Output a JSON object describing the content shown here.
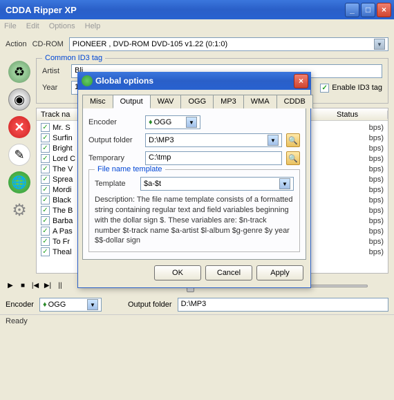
{
  "window": {
    "title": "CDDA Ripper XP"
  },
  "menu": {
    "file": "File",
    "edit": "Edit",
    "options": "Options",
    "help": "Help"
  },
  "actionbar": {
    "action": "Action",
    "cdrom": "CD-ROM",
    "device": "PIONEER , DVD-ROM DVD-105  v1.22 (0:1:0)"
  },
  "id3": {
    "legend": "Common ID3 tag",
    "artist_label": "Artist",
    "artist_value": "Bli",
    "year_label": "Year",
    "year_value": "19",
    "enable_label": "Enable ID3 tag"
  },
  "tracks": {
    "header": {
      "name": "Track na",
      "status": "Status"
    },
    "items": [
      {
        "name": "Mr. S",
        "status": "bps)"
      },
      {
        "name": "Surfin",
        "status": "bps)"
      },
      {
        "name": "Bright",
        "status": "bps)"
      },
      {
        "name": "Lord C",
        "status": "bps)"
      },
      {
        "name": "The V",
        "status": "bps)"
      },
      {
        "name": "Sprea",
        "status": "bps)"
      },
      {
        "name": "Mordi",
        "status": "bps)"
      },
      {
        "name": "Black",
        "status": "bps)"
      },
      {
        "name": "The B",
        "status": "bps)"
      },
      {
        "name": "Barba",
        "status": "bps)"
      },
      {
        "name": "A Pas",
        "status": "bps)"
      },
      {
        "name": "To Fr",
        "status": "bps)"
      },
      {
        "name": "Theal",
        "status": "bps)"
      }
    ]
  },
  "bottom": {
    "encoder_label": "Encoder",
    "encoder_value": "OGG",
    "output_label": "Output folder",
    "output_value": "D:\\MP3"
  },
  "status": "Ready",
  "dialog": {
    "title": "Global options",
    "tabs": {
      "misc": "Misc",
      "output": "Output",
      "wav": "WAV",
      "ogg": "OGG",
      "mp3": "MP3",
      "wma": "WMA",
      "cddb": "CDDB"
    },
    "encoder_label": "Encoder",
    "encoder_value": "OGG",
    "output_label": "Output folder",
    "output_value": "D:\\MP3",
    "temp_label": "Temporary",
    "temp_value": "C:\\tmp",
    "template_legend": "File name template",
    "template_label": "Template",
    "template_value": "$a-$t",
    "desc": "Description: The file name template consists of a formatted string containing regular text and field variables beginning with the dollar sign $. These variables are:\n$n-track number $t-track name $a-artist $l-album $g-genre $y year $$-dollar sign",
    "ok": "OK",
    "cancel": "Cancel",
    "apply": "Apply"
  }
}
